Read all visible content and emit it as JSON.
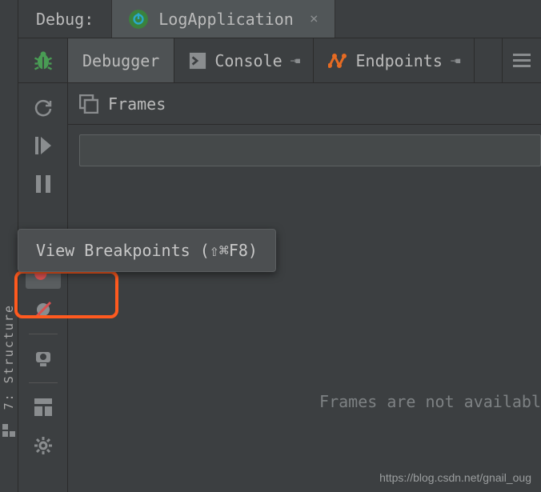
{
  "sidebar": {
    "structure_label": "7: Structure"
  },
  "tabs": {
    "debug_label": "Debug:",
    "run_config": {
      "label": "LogApplication",
      "close": "×"
    }
  },
  "subtabs": {
    "debugger": "Debugger",
    "console": "Console",
    "endpoints": "Endpoints"
  },
  "frames": {
    "title": "Frames",
    "empty": "Frames are not availabl"
  },
  "tooltip": {
    "text": "View Breakpoints (⇧⌘F8)"
  },
  "watermark": "https://blog.csdn.net/gnail_oug"
}
